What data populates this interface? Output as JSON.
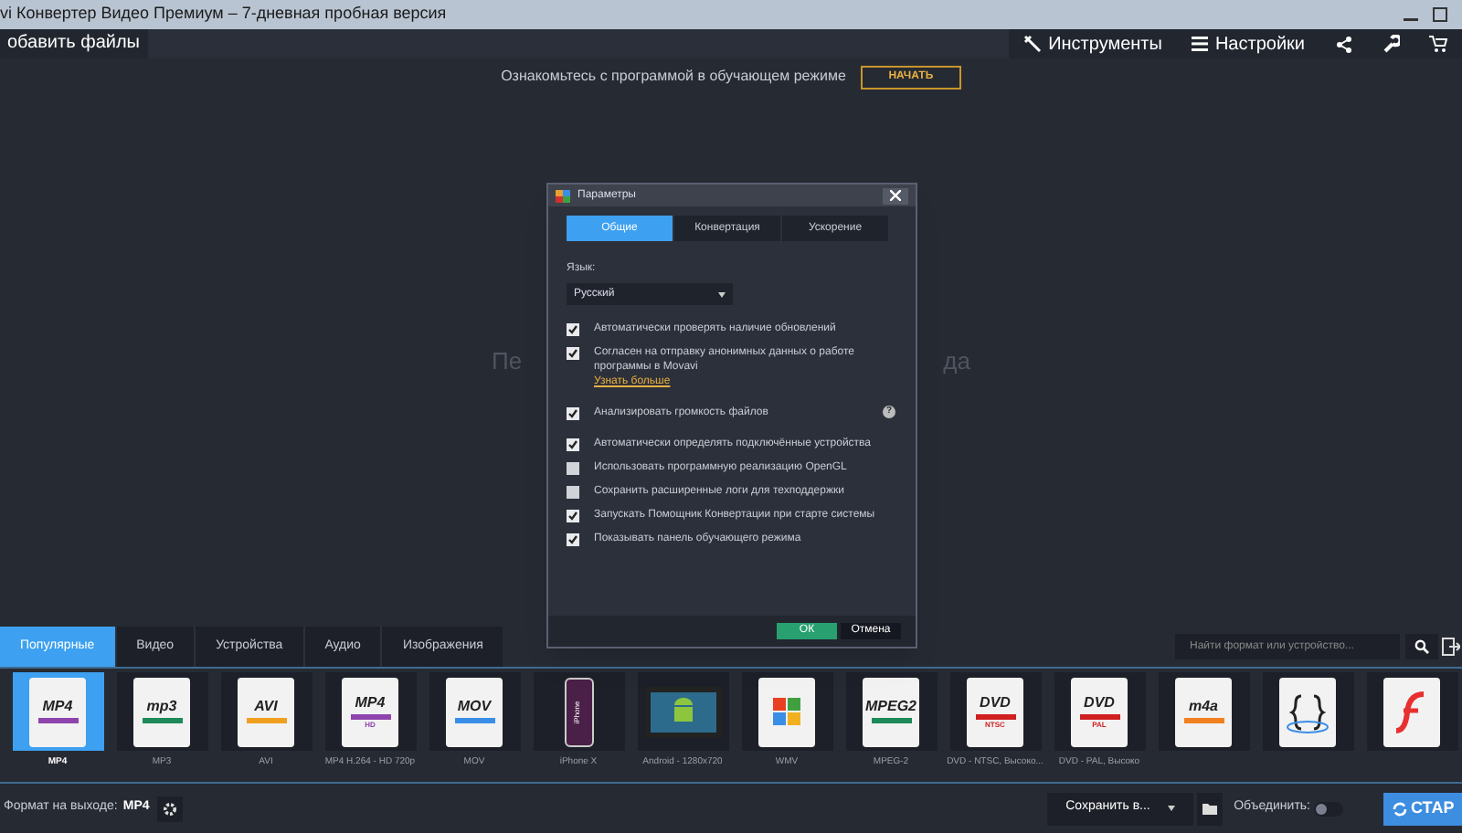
{
  "window": {
    "title": "vi Конвертер Видео Премиум – 7-дневная пробная версия"
  },
  "toolbar": {
    "add_files": "обавить файлы",
    "tools": "Инструменты",
    "settings": "Настройки"
  },
  "banner": {
    "text": "Ознакомьтесь с программой в обучающем режиме",
    "button": "НАЧАТЬ"
  },
  "drop_hint": {
    "left": "Пе",
    "right": "да"
  },
  "dialog": {
    "title": "Параметры",
    "tabs": [
      {
        "label": "Общие",
        "selected": true
      },
      {
        "label": "Конвертация",
        "selected": false
      },
      {
        "label": "Ускорение",
        "selected": false
      }
    ],
    "language_label": "Язык:",
    "language": "Русский",
    "options": [
      {
        "label": "Автоматически проверять наличие обновлений",
        "checked": true
      },
      {
        "label": "Согласен на отправку анонимных данных о работе программы в Movavi",
        "checked": true,
        "link": "Узнать больше"
      },
      {
        "label": "Анализировать громкость файлов",
        "checked": true,
        "help": "?"
      },
      {
        "label": "Автоматически определять подключённые устройства",
        "checked": true
      },
      {
        "label": "Использовать программную реализацию OpenGL",
        "checked": false
      },
      {
        "label": "Сохранить расширенные логи для техподдержки",
        "checked": false
      },
      {
        "label": "Запускать Помощник Конвертации при старте системы",
        "checked": true
      },
      {
        "label": "Показывать панель обучающего режима",
        "checked": true
      }
    ],
    "ok": "ОК",
    "cancel": "Отмена"
  },
  "format_tabs": [
    {
      "label": "Популярные",
      "selected": true
    },
    {
      "label": "Видео",
      "selected": false
    },
    {
      "label": "Устройства",
      "selected": false
    },
    {
      "label": "Аудио",
      "selected": false
    },
    {
      "label": "Изображения",
      "selected": false
    }
  ],
  "search": {
    "placeholder": "Найти формат или устройство..."
  },
  "formats": [
    {
      "kind": "doc",
      "badge": "MP4",
      "label": "MP4",
      "selected": true,
      "color": "#8e44ad"
    },
    {
      "kind": "doc",
      "badge": "mp3",
      "label": "MP3",
      "selected": false,
      "color": "#1e8a5a"
    },
    {
      "kind": "doc",
      "badge": "AVI",
      "label": "AVI",
      "selected": false,
      "color": "#f0a020"
    },
    {
      "kind": "doc",
      "badge": "MP4",
      "sub": "HD",
      "label": "MP4 H.264 - HD 720p",
      "selected": false,
      "color": "#8e44ad"
    },
    {
      "kind": "doc",
      "badge": "MOV",
      "label": "MOV",
      "selected": false,
      "color": "#3a8ee6"
    },
    {
      "kind": "phone",
      "badge": "iPhone",
      "label": "iPhone X",
      "selected": false
    },
    {
      "kind": "android",
      "label": "Android - 1280x720",
      "selected": false
    },
    {
      "kind": "windows",
      "label": "WMV",
      "selected": false
    },
    {
      "kind": "doc",
      "badge": "MPEG2",
      "label": "MPEG-2",
      "selected": false,
      "color": "#1e8a5a"
    },
    {
      "kind": "doc",
      "badge": "DVD",
      "sub": "NTSC",
      "label": "DVD - NTSC, Высоко...",
      "selected": false,
      "color": "#d02020"
    },
    {
      "kind": "doc",
      "badge": "DVD",
      "sub": "PAL",
      "label": "DVD - PAL, Высоко",
      "selected": false,
      "color": "#d02020"
    },
    {
      "kind": "doc",
      "badge": "m4a",
      "selected": false,
      "color": "#f08020"
    },
    {
      "kind": "braces",
      "selected": false
    },
    {
      "kind": "flash",
      "selected": false
    }
  ],
  "bottom": {
    "output_label": "Формат на выходе:",
    "output_value": "MP4",
    "save_to": "Сохранить в...",
    "merge": "Объединить:",
    "merge_on": false,
    "start": "СТАР"
  }
}
